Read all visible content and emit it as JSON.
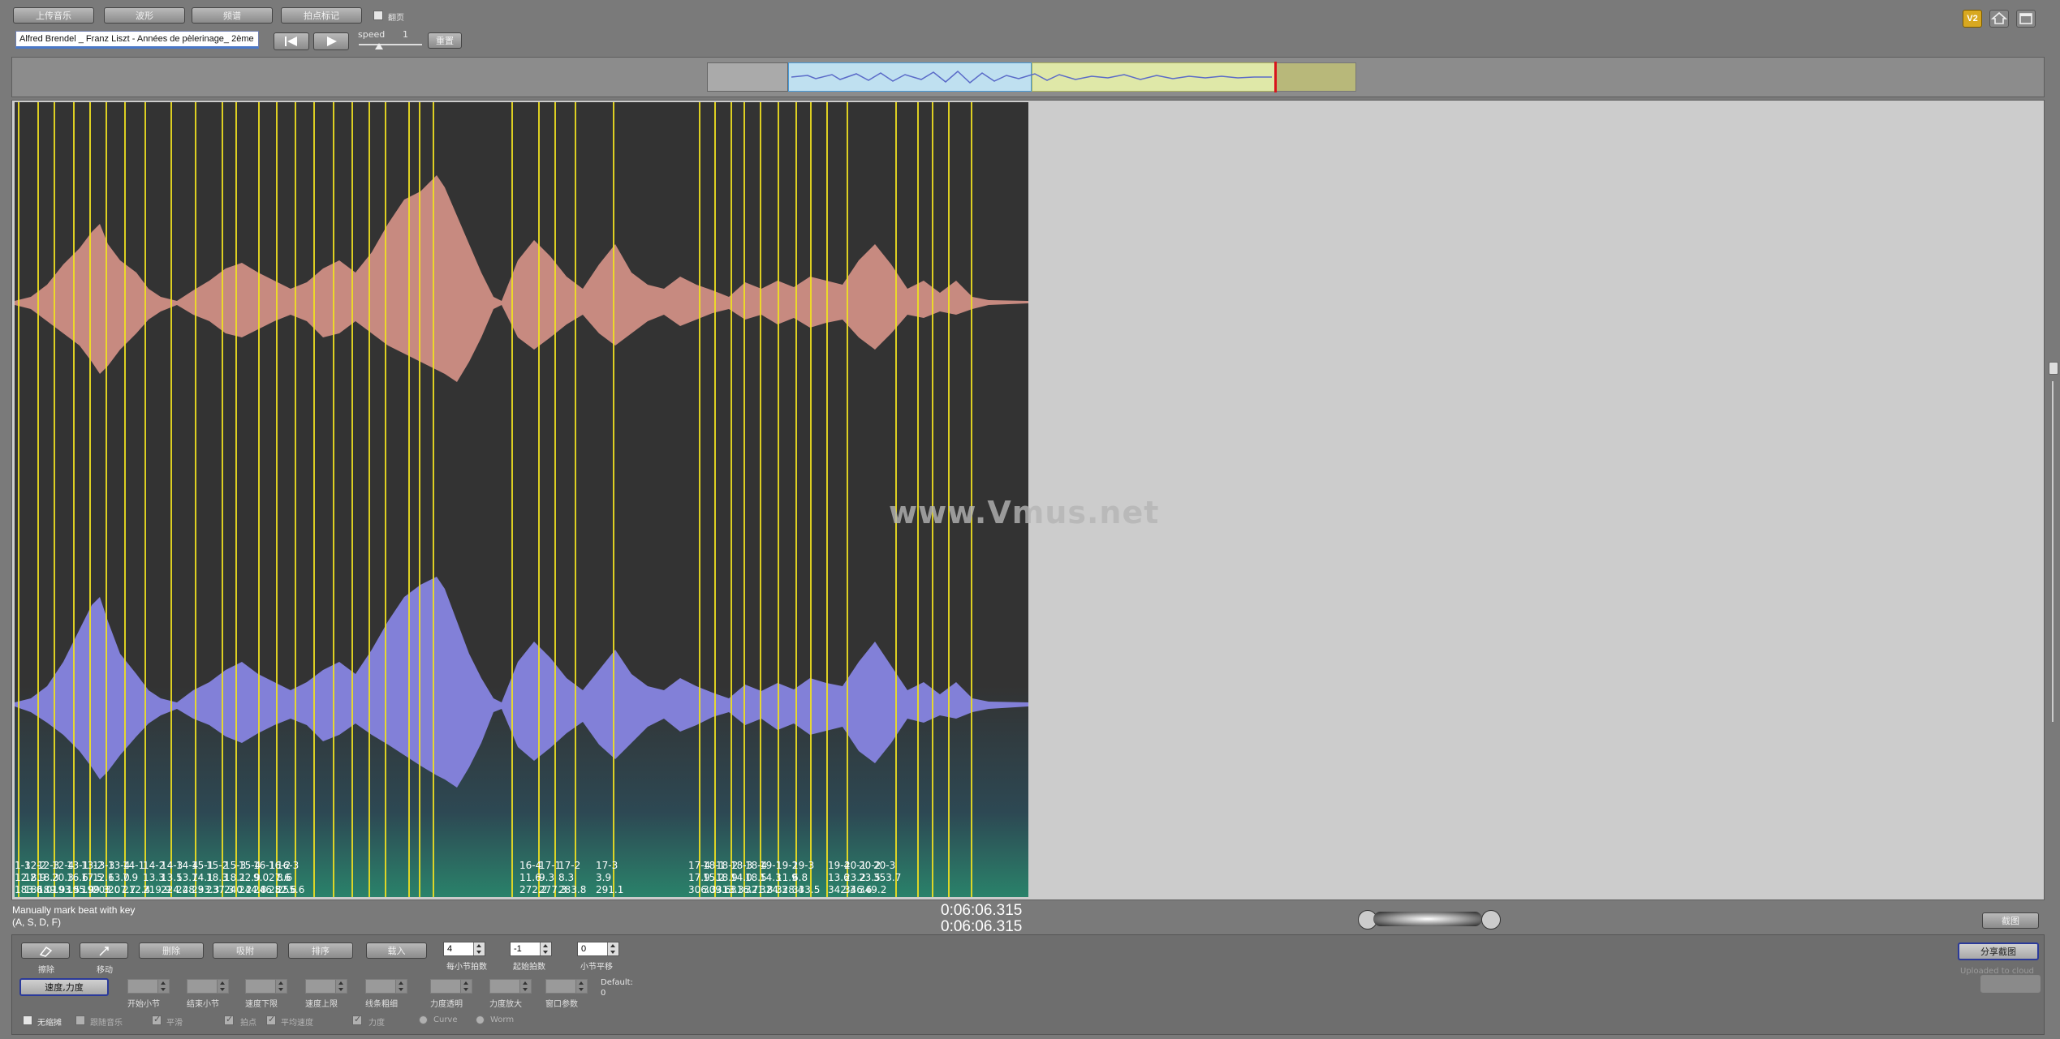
{
  "top_toolbar": {
    "upload_music": "上传音乐",
    "waveform": "波形",
    "spectrum": "频谱",
    "beat_marks": "拍点标记",
    "turn_page_label": "翻页",
    "file_name": "Alfred Brendel _ Franz Liszt - Années de pèlerinage_ 2ème",
    "speed_label": "speed",
    "speed_value": "1",
    "reset_label": "重置"
  },
  "top_right_icons": [
    "v2-badge-icon",
    "home-icon",
    "window-icon"
  ],
  "watermark": "www.Vmus.net",
  "status": {
    "hint_line1": "Manually mark beat with key",
    "hint_line2": "(A, S, D, F)",
    "time_current": "0:06:06.315",
    "time_total": "0:06:06.315",
    "close_label": "截图"
  },
  "measure_markers": [
    {
      "l1": "1-3",
      "l2": "12.2",
      "l3": "183.0"
    },
    {
      "l1": "12-2",
      "l2": "18.9",
      "l3": "186.0"
    },
    {
      "l1": "12-3",
      "l2": "18.3",
      "l3": "189.9"
    },
    {
      "l1": "12-4",
      "l2": "20.3",
      "l3": "193.5"
    },
    {
      "l1": "13-1",
      "l2": "16.6",
      "l3": "195.9"
    },
    {
      "l1": "13-2",
      "l2": "17.5",
      "l3": "199.3"
    },
    {
      "l1": "13-3",
      "l2": "12.6",
      "l3": "203.0"
    },
    {
      "l1": "13-4",
      "l2": "13.0",
      "l3": "207.7"
    },
    {
      "l1": "14-1",
      "l2": "7.9",
      "l3": "212.4"
    },
    {
      "l1": "14-2",
      "l2": "13.3",
      "l3": "219.9"
    },
    {
      "l1": "14-3",
      "l2": "13.5",
      "l3": "224.4"
    },
    {
      "l1": "14-4",
      "l2": "13.7",
      "l3": "228.9"
    },
    {
      "l1": "15-1",
      "l2": "14.1",
      "l3": "233.3"
    },
    {
      "l1": "15-2",
      "l2": "18.3",
      "l3": "237.3"
    },
    {
      "l1": "15-3",
      "l2": "18.1",
      "l3": "240.2"
    },
    {
      "l1": "15-4",
      "l2": "22.9",
      "l3": "244.8"
    },
    {
      "l1": "16-1",
      "l2": "9.0",
      "l3": "246.8"
    },
    {
      "l1": "16-2",
      "l2": "27.6",
      "l3": "252.6"
    },
    {
      "l1": "16-3",
      "l2": "8.6",
      "l3": "255.6"
    },
    {
      "l1": "16-4",
      "l2": "11.6",
      "l3": "272.2"
    },
    {
      "l1": "17-1",
      "l2": "9.3",
      "l3": "277.3"
    },
    {
      "l1": "17-2",
      "l2": "8.3",
      "l3": "283.8"
    },
    {
      "l1": "17-3",
      "l2": "3.9",
      "l3": "291.1"
    },
    {
      "l1": "17-4",
      "l2": "17.9",
      "l3": "306.3"
    },
    {
      "l1": "18-1",
      "l2": "15.2",
      "l3": "309.6"
    },
    {
      "l1": "18-2",
      "l2": "18.9",
      "l3": "313.3"
    },
    {
      "l1": "18-3",
      "l2": "14.0",
      "l3": "316.7"
    },
    {
      "l1": "18-4",
      "l2": "18.5",
      "l3": "321.8"
    },
    {
      "l1": "19-1",
      "l2": "14.3",
      "l3": "324.3"
    },
    {
      "l1": "19-2",
      "l2": "11.9",
      "l3": "328.4"
    },
    {
      "l1": "19-3",
      "l2": "6.8",
      "l3": "333.5"
    },
    {
      "l1": "19-4",
      "l2": "13.6",
      "l3": "342.3"
    },
    {
      "l1": "20-1",
      "l2": "23.2",
      "l3": "346.6"
    },
    {
      "l1": "20-2",
      "l2": "23.5",
      "l3": "349.2"
    },
    {
      "l1": "20-3",
      "l2": "",
      "l3": "353.7"
    }
  ],
  "bottom_toolbar": {
    "erase_label": "擦除",
    "move_label": "移动",
    "delete_label": "删除",
    "align_label": "吸附",
    "sort_label": "排序",
    "load_label": "载入",
    "beats_per_measure_value": "4",
    "beats_per_measure_label": "每小节拍数",
    "start_beat_value": "-1",
    "start_beat_label": "起始拍数",
    "measure_offset_value": "0",
    "measure_offset_label": "小节平移",
    "tempo_dynamics_label": "速度,力度",
    "start_measure_label": "开始小节",
    "end_measure_label": "结束小节",
    "tempo_low_label": "速度下限",
    "tempo_high_label": "速度上限",
    "line_thickness_label": "线条粗细",
    "dyn_transparency_label": "力度透明",
    "dyn_magnify_label": "力度放大",
    "window_params_label": "窗口参数",
    "default_label": "Default:",
    "default_value": "0",
    "no_repeat_label": "无缩摊",
    "follow_music_label": "跟随音乐",
    "smooth_label": "平滑",
    "beat_point_label": "拍点",
    "avg_tempo_label": "平均速度",
    "dynamics_label": "力度",
    "curve_label": "Curve",
    "worm_label": "Worm",
    "share_label": "分享截图",
    "uploaded_label": "Uploaded to cloud"
  }
}
